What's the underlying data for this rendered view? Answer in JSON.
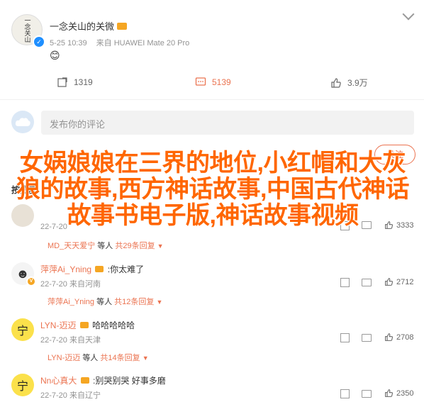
{
  "colors": {
    "orange": "#eb7350",
    "title": "#ff6600",
    "blue": "#1f8fff",
    "gray": "#939393"
  },
  "post": {
    "author": "一念关山的关微",
    "avatar_text": "一念关山",
    "time": "5-25 10:39",
    "source": "来自 HUAWEI Mate 20 Pro",
    "emoji_line": "😊"
  },
  "stats": {
    "repost": "1319",
    "comment": "5139",
    "like": "3.9万"
  },
  "comment_box": {
    "placeholder": "发布你的评论"
  },
  "follow_button": "关注",
  "hot_label": "按热度",
  "overlay_title": "女娲娘娘在三界的地位,小红帽和大灰狼的故事,西方神话故事,中国古代神话故事书电子版,神话故事视频",
  "comments": [
    {
      "id": "c1",
      "name": "",
      "text": "",
      "time": "22-7-20",
      "likes": "3333",
      "reply_name": "MD_天天爱宁",
      "reply_text": "等人",
      "reply_more": "共29条回复"
    },
    {
      "id": "c2",
      "name": "萍萍Ai_Yning",
      "text": ":你太难了",
      "time": "22-7-20 来自河南",
      "likes": "2712",
      "reply_name": "萍萍Ai_Yning",
      "reply_text": "等人",
      "reply_more": "共12条回复"
    },
    {
      "id": "c3",
      "name": "LYN-迈迈",
      "text": "哈哈哈哈哈",
      "time": "22-7-20 来自天津",
      "likes": "2708",
      "reply_name": "LYN-迈迈",
      "reply_text": "等人",
      "reply_more": "共14条回复"
    },
    {
      "id": "c4",
      "name": "Nn心真大",
      "text": ":别哭别哭 好事多磨",
      "time": "22-7-20 来自辽宁",
      "likes": "2350",
      "reply_name": "",
      "reply_text": "",
      "reply_more": ""
    }
  ]
}
